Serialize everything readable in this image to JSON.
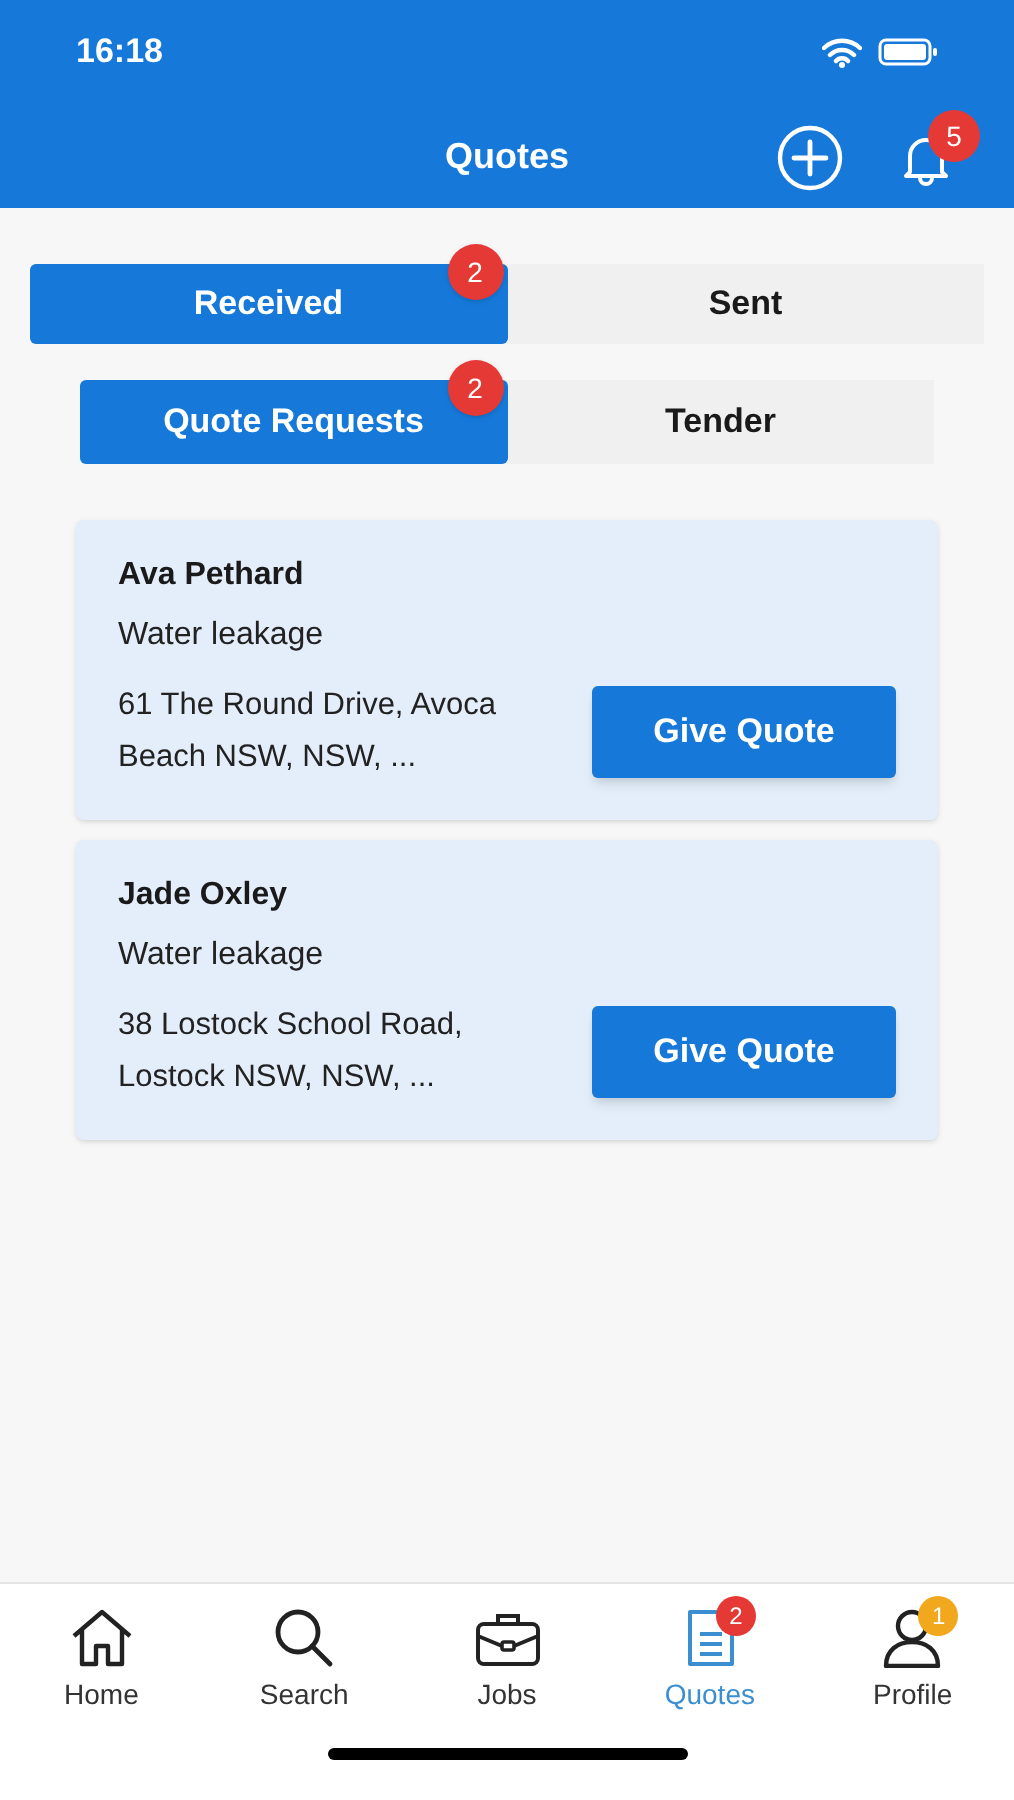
{
  "status_bar": {
    "time": "16:18"
  },
  "header": {
    "title": "Quotes",
    "notification_count": "5"
  },
  "tabs": [
    {
      "label": "Received",
      "selected": true,
      "badge": "2"
    },
    {
      "label": "Sent",
      "selected": false
    }
  ],
  "sub_tabs": [
    {
      "label": "Quote Requests",
      "selected": true,
      "badge": "2"
    },
    {
      "label": "Tender",
      "selected": false
    }
  ],
  "requests": [
    {
      "name": "Ava Pethard",
      "issue": "Water leakage",
      "address": "61 The Round Drive, Avoca Beach NSW, NSW, ...",
      "action": "Give Quote"
    },
    {
      "name": "Jade Oxley",
      "issue": "Water leakage",
      "address": "38 Lostock School Road, Lostock NSW, NSW, ...",
      "action": "Give Quote"
    }
  ],
  "nav": [
    {
      "kind": "home",
      "label": "Home",
      "selected": false
    },
    {
      "kind": "search",
      "label": "Search",
      "selected": false
    },
    {
      "kind": "jobs",
      "label": "Jobs",
      "selected": false
    },
    {
      "kind": "quotes",
      "label": "Quotes",
      "selected": true,
      "badge": {
        "text": "2",
        "color": "#e53935"
      }
    },
    {
      "kind": "profile",
      "label": "Profile",
      "selected": false,
      "badge": {
        "text": "1",
        "color": "#f2a81d"
      }
    }
  ]
}
